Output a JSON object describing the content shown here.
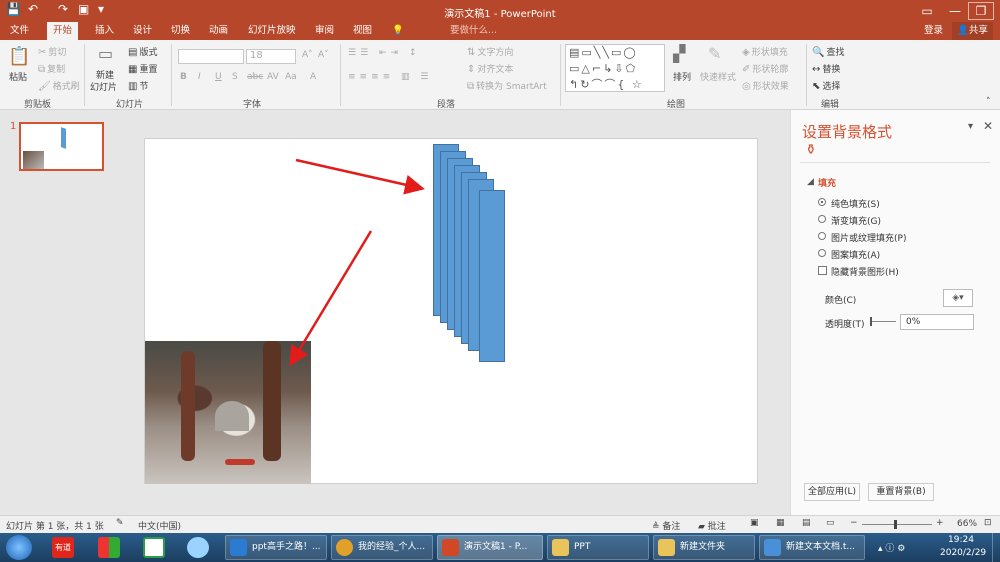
{
  "window": {
    "title": "演示文稿1 - PowerPoint",
    "min_icon": "minimize-icon",
    "max_icon": "restore-icon",
    "close_icon": "close-icon"
  },
  "tabs": [
    "文件",
    "开始",
    "插入",
    "设计",
    "切换",
    "动画",
    "幻灯片放映",
    "审阅",
    "视图"
  ],
  "active_tab": "开始",
  "tell_me": "要做什么...",
  "account": {
    "login": "登录",
    "share": "共享"
  },
  "ribbon": {
    "clipboard": {
      "label": "剪贴板",
      "paste": "粘贴",
      "cut": "剪切",
      "copy": "复制",
      "format_painter": "格式刷"
    },
    "slides": {
      "label": "幻灯片",
      "new_slide_1": "新建",
      "new_slide_2": "幻灯片",
      "layout": "版式",
      "reset": "重置",
      "section": "节"
    },
    "font": {
      "label": "字体",
      "size": "18",
      "bold": "B",
      "italic": "I",
      "underline": "U",
      "strike": "S",
      "shadow": "abc",
      "spacing": "AV",
      "case": "Aa",
      "color": "A"
    },
    "paragraph": {
      "label": "段落",
      "text_direction": "文字方向",
      "align_text": "对齐文本",
      "smartart": "转换为 SmartArt"
    },
    "drawing": {
      "label": "绘图",
      "arrange": "排列",
      "quick_styles": "快速样式",
      "shape_fill": "形状填充",
      "shape_outline": "形状轮廓",
      "shape_effects": "形状效果"
    },
    "editing": {
      "label": "编辑",
      "find": "查找",
      "replace": "替换",
      "select": "选择"
    }
  },
  "thumbnail_number": "1",
  "format_pane": {
    "title": "设置背景格式",
    "section": "填充",
    "options": [
      "纯色填充(S)",
      "渐变填充(G)",
      "图片或纹理填充(P)",
      "图案填充(A)"
    ],
    "selected_option": "纯色填充(S)",
    "hide_bg": "隐藏背景图形(H)",
    "color_label": "颜色(C)",
    "transparency_label": "透明度(T)",
    "transparency_value": "0%",
    "apply_all": "全部应用(L)",
    "reset_bg": "重置背景(B)"
  },
  "statusbar": {
    "slide_info": "幻灯片 第 1 张，共 1 张",
    "language": "中文(中国)",
    "notes": "备注",
    "comments": "批注",
    "zoom": "66%"
  },
  "taskbar": {
    "apps": [
      {
        "label": "ppt高手之路！...",
        "color": "#2b7bd3"
      },
      {
        "label": "我的经验_个人...",
        "color": "#e0a02a"
      },
      {
        "label": "演示文稿1 - P...",
        "color": "#d24726"
      },
      {
        "label": "PPT",
        "color": "#e8c45a"
      },
      {
        "label": "新建文件夹",
        "color": "#e8c45a"
      },
      {
        "label": "新建文本文档.t...",
        "color": "#4a90d9"
      }
    ],
    "pinned": [
      {
        "name": "youdao",
        "label": "有道"
      }
    ],
    "time": "19:24",
    "date": "2020/2/29"
  },
  "colors": {
    "accent": "#b7472a",
    "shape_fill": "#5b9bd5",
    "arrow": "#e21b1b"
  }
}
